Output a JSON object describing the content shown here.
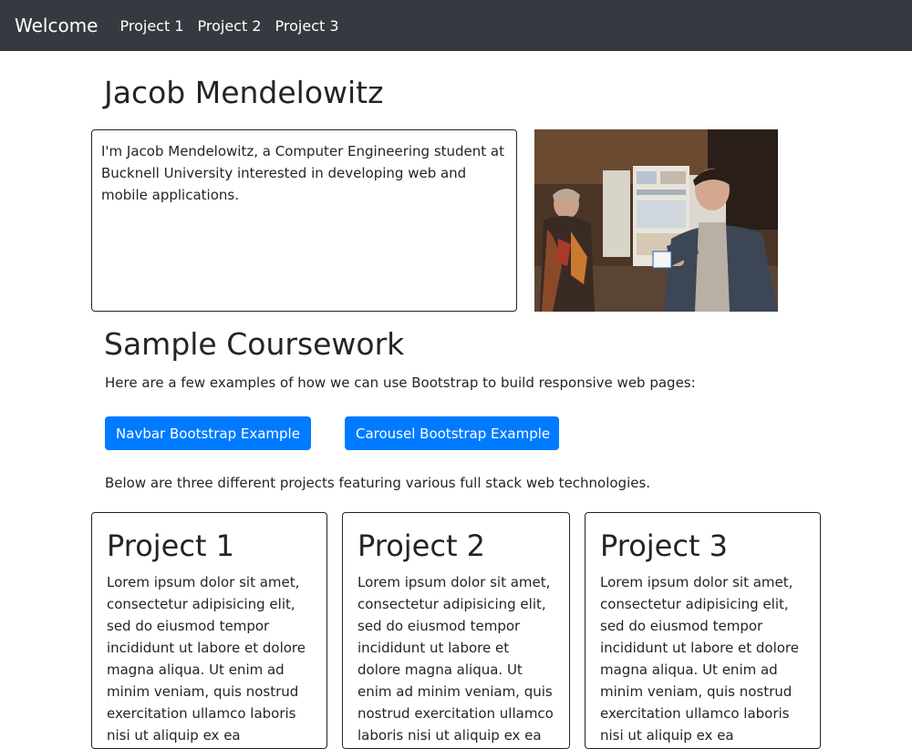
{
  "navbar": {
    "brand": "Welcome",
    "links": [
      "Project 1",
      "Project 2",
      "Project 3"
    ],
    "background_color": "#343a40"
  },
  "profile": {
    "name": "Jacob Mendelowitz",
    "bio": "I'm Jacob Mendelowitz, a Computer Engineering student at Bucknell University interested in developing web and mobile applications."
  },
  "coursework": {
    "title": "Sample Coursework",
    "intro": "Here are a few examples of how we can use Bootstrap to build responsive web pages:",
    "buttons": [
      "Navbar Bootstrap Example",
      "Carousel Bootstrap Example"
    ],
    "button_color": "#007bff",
    "below_text": "Below are three different projects featuring various full stack web technologies."
  },
  "projects": [
    {
      "title": "Project 1",
      "text": "Lorem ipsum dolor sit amet, consectetur adipisicing elit, sed do eiusmod tempor incididunt ut labore et dolore magna aliqua. Ut enim ad minim veniam, quis nostrud exercitation ullamco laboris nisi ut aliquip ex ea commodo"
    },
    {
      "title": "Project 2",
      "text": "Lorem ipsum dolor sit amet, consectetur adipisicing elit, sed do eiusmod tempor incididunt ut labore et dolore magna aliqua. Ut enim ad minim veniam, quis nostrud exercitation ullamco laboris nisi ut aliquip ex ea commodo"
    },
    {
      "title": "Project 3",
      "text": "Lorem ipsum dolor sit amet, consectetur adipisicing elit, sed do eiusmod tempor incididunt ut labore et dolore magna aliqua. Ut enim ad minim veniam, quis nostrud exercitation ullamco laboris nisi ut aliquip ex ea commodo"
    }
  ]
}
